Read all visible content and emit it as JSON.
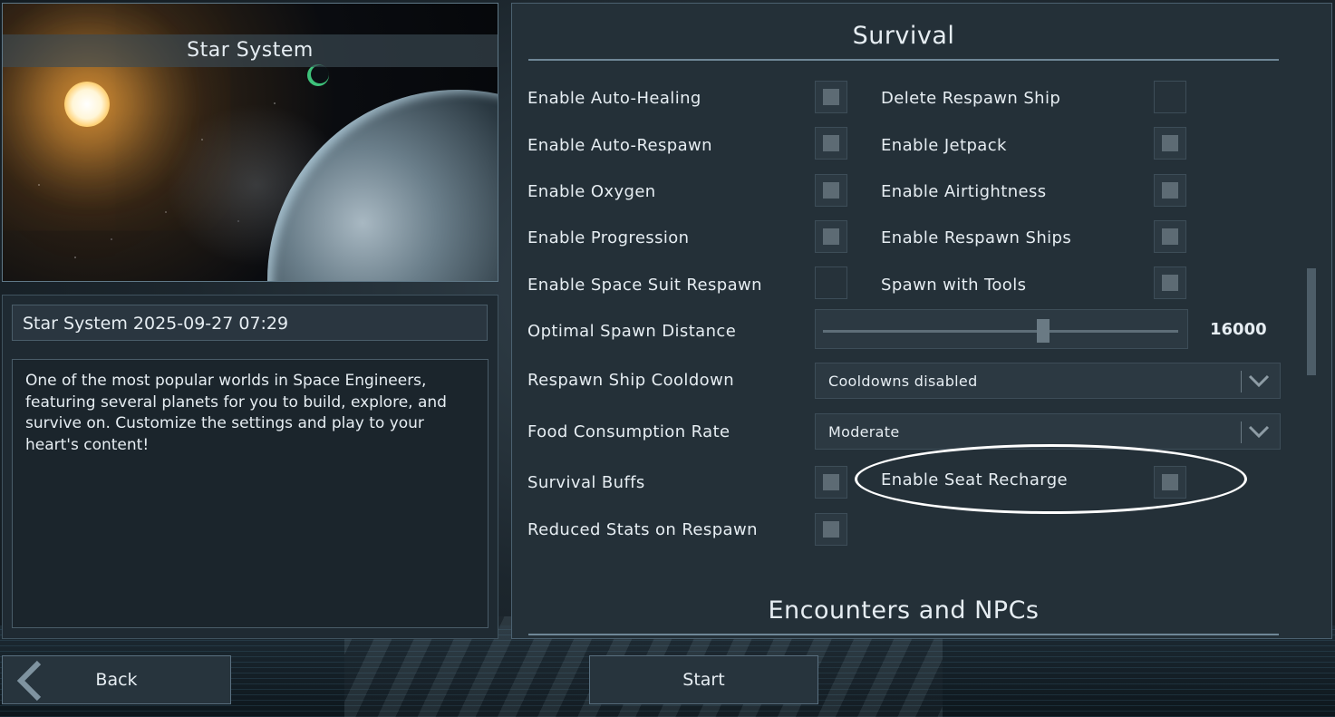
{
  "preview": {
    "title": "Star System"
  },
  "world": {
    "name": "Star System 2025-09-27 07:29",
    "description": "One of the most popular worlds in Space Engineers, featuring several planets for you to build, explore, and survive on. Customize the settings and play to your heart's content!"
  },
  "survival": {
    "title": "Survival",
    "left_options": [
      {
        "label": "Enable Auto-Healing",
        "checked": false
      },
      {
        "label": "Enable Auto-Respawn",
        "checked": false
      },
      {
        "label": "Enable Oxygen",
        "checked": false
      },
      {
        "label": "Enable Progression",
        "checked": false
      },
      {
        "label": "Enable Space Suit Respawn",
        "checked": false
      }
    ],
    "right_options": [
      {
        "label": "Delete Respawn Ship",
        "checked": false
      },
      {
        "label": "Enable Jetpack",
        "checked": false
      },
      {
        "label": "Enable Airtightness",
        "checked": false
      },
      {
        "label": "Enable Respawn Ships",
        "checked": false
      },
      {
        "label": "Spawn with Tools",
        "checked": false
      }
    ],
    "optimal_spawn_distance": {
      "label": "Optimal Spawn Distance",
      "value": "16000",
      "fraction": 0.62
    },
    "respawn_ship_cooldown": {
      "label": "Respawn Ship Cooldown",
      "selected": "Cooldowns disabled"
    },
    "food_consumption_rate": {
      "label": "Food Consumption Rate",
      "selected": "Moderate"
    },
    "survival_buffs": {
      "label": "Survival Buffs",
      "checked": false
    },
    "seat_recharge": {
      "label": "Enable Seat Recharge",
      "checked": false
    },
    "reduced_stats": {
      "label": "Reduced Stats on Respawn",
      "checked": false
    }
  },
  "encounters": {
    "title": "Encounters and NPCs"
  },
  "buttons": {
    "back": "Back",
    "start": "Start"
  },
  "colors": {
    "panel": "#243038",
    "checkbox_inner": "#5d6b74",
    "highlight": "#ffffff"
  },
  "icons": {
    "back": "chevron-left-icon",
    "dropdown": "chevron-down-icon"
  }
}
